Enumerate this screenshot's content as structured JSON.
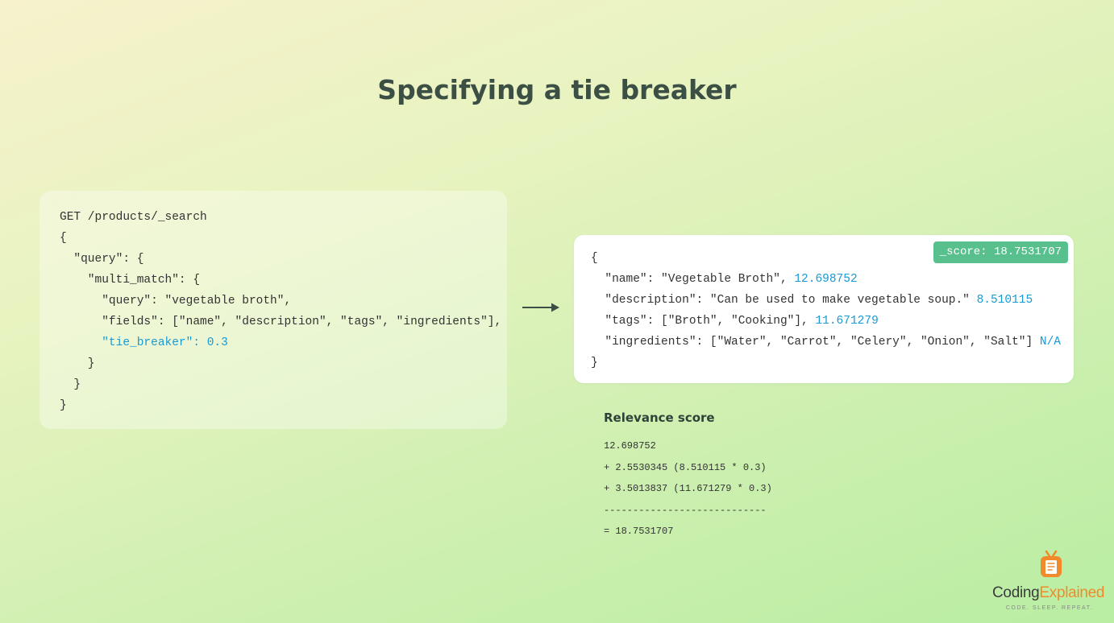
{
  "title": "Specifying a tie breaker",
  "query_lines": [
    "GET /products/_search",
    "{",
    "  \"query\": {",
    "    \"multi_match\": {",
    "      \"query\": \"vegetable broth\",",
    "      \"fields\": [\"name\", \"description\", \"tags\", \"ingredients\"],",
    "      \"tie_breaker\": 0.3",
    "    }",
    "  }",
    "}"
  ],
  "result": {
    "score_badge": "_score: 18.7531707",
    "open_brace": "{",
    "close_brace": "}",
    "fields": [
      {
        "text": "  \"name\": \"Vegetable Broth\", ",
        "score": "12.698752"
      },
      {
        "text": "  \"description\": \"Can be used to make vegetable soup.\" ",
        "score": "8.510115"
      },
      {
        "text": "  \"tags\": [\"Broth\", \"Cooking\"], ",
        "score": "11.671279"
      },
      {
        "text": "  \"ingredients\": [\"Water\", \"Carrot\", \"Celery\", \"Onion\", \"Salt\"] ",
        "score": "N/A"
      }
    ]
  },
  "relevance": {
    "title": "Relevance score",
    "lines": [
      "12.698752",
      "+ 2.5530345 (8.510115 * 0.3)",
      "+ 3.5013837 (11.671279 * 0.3)",
      "----------------------------",
      "= 18.7531707"
    ]
  },
  "logo": {
    "word_part1": "Coding",
    "word_part2": "Explained",
    "tagline": "CODE. SLEEP. REPEAT.",
    "icon": "tv-document-icon"
  },
  "colors": {
    "highlight": "#1a9ad4",
    "badge": "#58c08d",
    "logo_orange": "#f08a2a"
  }
}
